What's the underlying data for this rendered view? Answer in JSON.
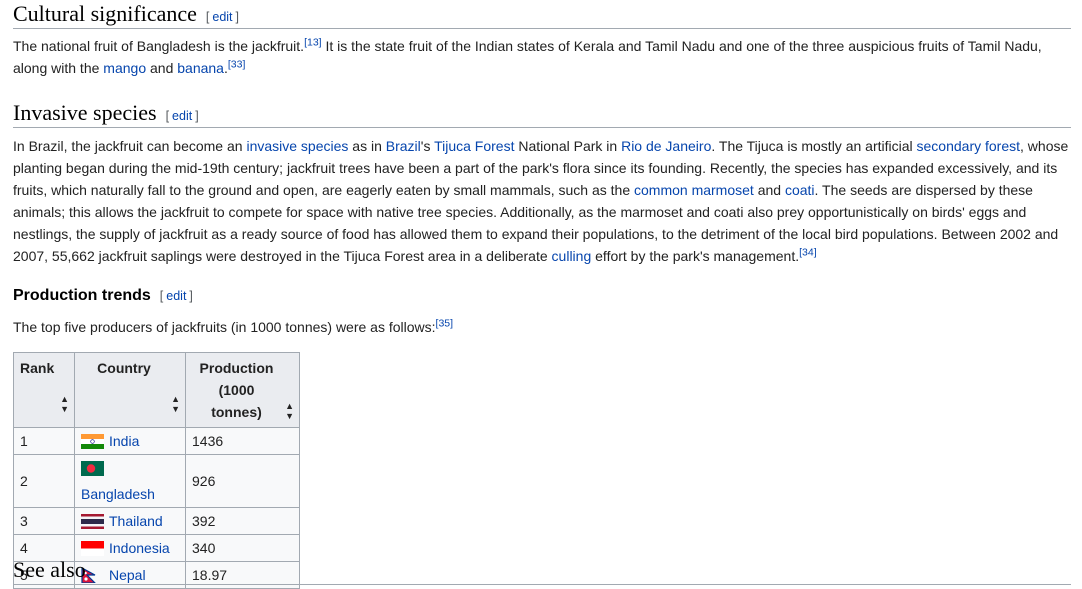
{
  "edit_label": "edit",
  "cultural": {
    "heading": "Cultural significance",
    "text_1": "The national fruit of Bangladesh is the jackfruit.",
    "ref_1": "[13]",
    "text_2": " It is the state fruit of the Indian states of Kerala and Tamil Nadu and one of the three auspicious fruits of Tamil Nadu, along with the ",
    "link_mango": "mango",
    "text_3": " and ",
    "link_banana": "banana",
    "text_4": ".",
    "ref_2": "[33]"
  },
  "invasive": {
    "heading": "Invasive species",
    "t1": "In Brazil, the jackfruit can become an ",
    "l_invasive": "invasive species",
    "t2": " as in ",
    "l_brazil": "Brazil",
    "t3": "'s ",
    "l_tijuca": "Tijuca Forest",
    "t4": " National Park in ",
    "l_rio": "Rio de Janeiro",
    "t5": ". The Tijuca is mostly an artificial ",
    "l_secondary": "secondary forest",
    "t6": ", whose planting began during the mid-19th century; jackfruit trees have been a part of the park's flora since its founding. Recently, the species has expanded excessively, and its fruits, which naturally fall to the ground and open, are eagerly eaten by small mammals, such as the ",
    "l_marmoset": "common marmoset",
    "t7": " and ",
    "l_coati": "coati",
    "t8": ". The seeds are dispersed by these animals; this allows the jackfruit to compete for space with native tree species. Additionally, as the marmoset and coati also prey opportunistically on birds' eggs and nestlings, the supply of jackfruit as a ready source of food has allowed them to expand their populations, to the detriment of the local bird populations. Between 2002 and 2007, 55,662 jackfruit saplings were destroyed in the Tijuca Forest area in a deliberate ",
    "l_culling": "culling",
    "t9": " effort by the park's management.",
    "ref": "[34]"
  },
  "production": {
    "heading": "Production trends",
    "intro": "The top five producers of jackfruits (in 1000 tonnes) were as follows:",
    "ref": "[35]",
    "headers": {
      "rank": "Rank",
      "country": "Country",
      "production_1": "Production",
      "production_2": "(1000 tonnes)"
    },
    "sort_icon": "sort-arrows-icon",
    "rows": [
      {
        "rank": "1",
        "country": "India",
        "production": "1436",
        "flag": "india-flag-icon"
      },
      {
        "rank": "2",
        "country": "Bangladesh",
        "production": "926",
        "flag": "bangladesh-flag-icon"
      },
      {
        "rank": "3",
        "country": "Thailand",
        "production": "392",
        "flag": "thailand-flag-icon"
      },
      {
        "rank": "4",
        "country": "Indonesia",
        "production": "340",
        "flag": "indonesia-flag-icon"
      },
      {
        "rank": "5",
        "country": "Nepal",
        "production": "18.97",
        "flag": "nepal-flag-icon"
      }
    ]
  },
  "see_also": {
    "heading": "See also"
  },
  "colors": {
    "link": "#0645ad",
    "text": "#222222",
    "header_bg": "#eaecf0",
    "border": "#a2a9b1"
  }
}
